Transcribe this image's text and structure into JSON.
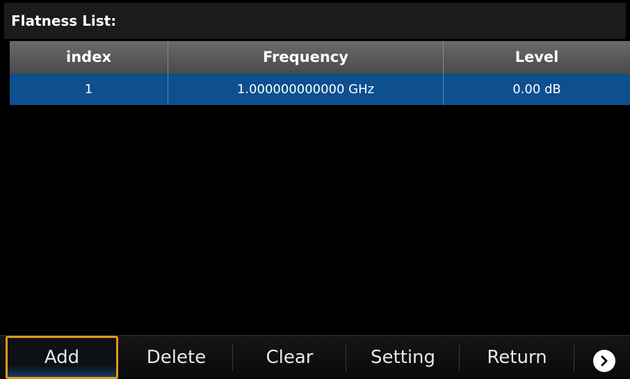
{
  "title": "Flatness List:",
  "table": {
    "headers": [
      "index",
      "Frequency",
      "Level"
    ],
    "rows": [
      {
        "index": "1",
        "frequency": "1.000000000000 GHz",
        "level": "0.00 dB"
      }
    ]
  },
  "softkeys": {
    "add": "Add",
    "delete": "Delete",
    "clear": "Clear",
    "setting": "Setting",
    "return": "Return"
  },
  "icons": {
    "more": "chevron-right-circle-icon"
  },
  "colors": {
    "selected_row": "#0d4f8f",
    "header_bg": "#5a5a5a",
    "active_border": "#e09a1a"
  }
}
